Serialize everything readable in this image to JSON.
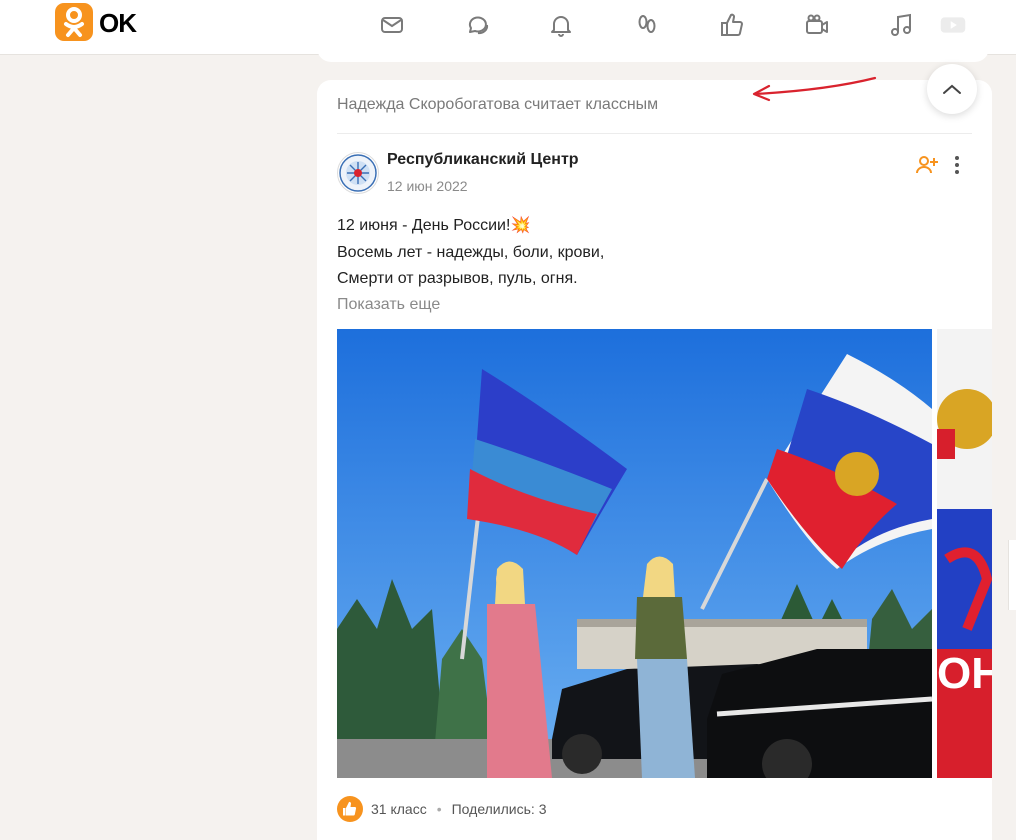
{
  "header": {
    "logo_text": "OK",
    "icons": [
      "mail-icon",
      "chat-icon",
      "bell-icon",
      "footprints-icon",
      "like-icon",
      "video-icon",
      "music-icon",
      "play-icon"
    ]
  },
  "post": {
    "liked_by_text": "Надежда Скоробогатова считает классным",
    "author": "Республиканский Центр",
    "date": "12 июн 2022",
    "text_lines": [
      "12 июня - День России!💥",
      "Восемь лет - надежды, боли, крови,",
      "Смерти от разрывов, пуль, огня."
    ],
    "show_more": "Показать еще",
    "likes": "31 класс",
    "shares": "Поделились: 3",
    "second_photo_partial_text": "ОН"
  },
  "colors": {
    "accent": "#f7931e",
    "page_bg": "#f5f2ef",
    "sky": "#2f7fe0"
  }
}
